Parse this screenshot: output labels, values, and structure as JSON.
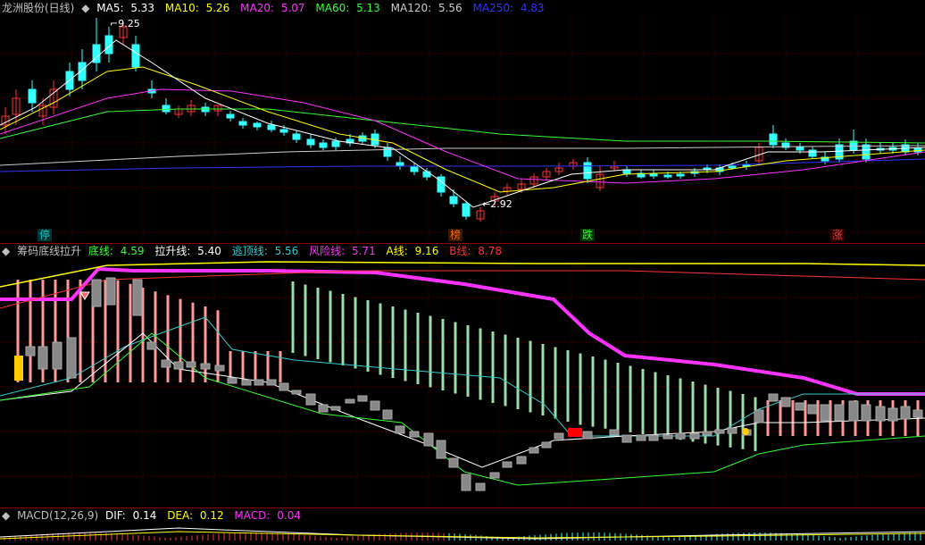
{
  "main": {
    "title": "龙洲股份(日线)",
    "ma_labels": [
      {
        "name": "MA5: ",
        "value": "5.33",
        "color": "#ffffff"
      },
      {
        "name": "MA10: ",
        "value": "5.26",
        "color": "#ffff00"
      },
      {
        "name": "MA20: ",
        "value": "5.07",
        "color": "#ff33ff"
      },
      {
        "name": "MA60: ",
        "value": "5.13",
        "color": "#33ff33"
      },
      {
        "name": "MA120: ",
        "value": "5.56",
        "color": "#cccccc"
      },
      {
        "name": "MA250: ",
        "value": "4.83",
        "color": "#3333ff"
      }
    ],
    "high_label": "9.25",
    "low_label": "2.92",
    "markers": [
      {
        "text": "停",
        "color": "#00cccc",
        "bg": "#003333"
      },
      {
        "text": "榜",
        "color": "#ff6600",
        "bg": "#331a00"
      },
      {
        "text": "跌",
        "color": "#33ff33",
        "bg": "#003300"
      },
      {
        "text": "涨",
        "color": "#ff3333",
        "bg": "#330000"
      }
    ]
  },
  "indicator": {
    "title": "筹码底线拉升",
    "labels": [
      {
        "name": "底线: ",
        "value": "4.59",
        "color": "#33ff33"
      },
      {
        "name": "拉升线: ",
        "value": "5.40",
        "color": "#ffffff"
      },
      {
        "name": "逃顶线: ",
        "value": "5.56",
        "color": "#33cccc"
      },
      {
        "name": "风险线: ",
        "value": "5.71",
        "color": "#ff33ff"
      },
      {
        "name": "A线: ",
        "value": "9.16",
        "color": "#ffff00"
      },
      {
        "name": "B线: ",
        "value": "8.78",
        "color": "#ff3333"
      }
    ]
  },
  "macd": {
    "title": "MACD(12,26,9)",
    "labels": [
      {
        "name": "DIF: ",
        "value": "0.14",
        "color": "#ffffff"
      },
      {
        "name": "DEA: ",
        "value": "0.12",
        "color": "#ffff00"
      },
      {
        "name": "MACD: ",
        "value": "0.04",
        "color": "#ff33ff"
      }
    ]
  },
  "colors": {
    "up": "#ff3333",
    "down": "#33ffff",
    "grid": "#8b0000",
    "bg": "#000000"
  }
}
